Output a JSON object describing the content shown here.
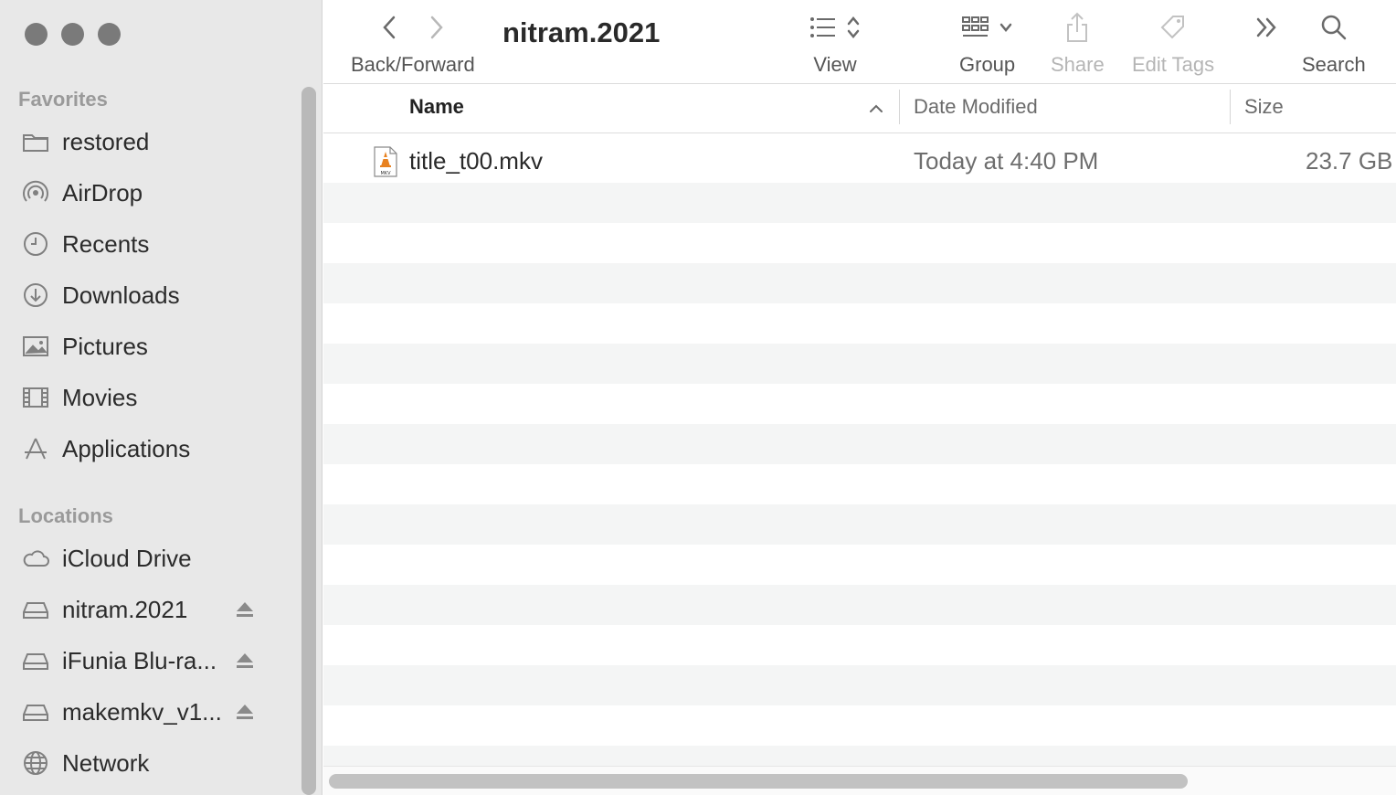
{
  "toolbar": {
    "title": "nitram.2021",
    "back_forward_label": "Back/Forward",
    "view_label": "View",
    "group_label": "Group",
    "share_label": "Share",
    "edit_tags_label": "Edit Tags",
    "search_label": "Search"
  },
  "sidebar": {
    "favorites_header": "Favorites",
    "locations_header": "Locations",
    "favorites": [
      {
        "label": "restored",
        "icon": "folder-icon"
      },
      {
        "label": "AirDrop",
        "icon": "airdrop-icon"
      },
      {
        "label": "Recents",
        "icon": "clock-icon"
      },
      {
        "label": "Downloads",
        "icon": "download-icon"
      },
      {
        "label": "Pictures",
        "icon": "photo-icon"
      },
      {
        "label": "Movies",
        "icon": "film-icon"
      },
      {
        "label": "Applications",
        "icon": "applications-icon"
      }
    ],
    "locations": [
      {
        "label": "iCloud Drive",
        "icon": "cloud-icon"
      },
      {
        "label": "nitram.2021",
        "icon": "drive-icon",
        "eject": true
      },
      {
        "label": "iFunia Blu-ra...",
        "icon": "drive-icon",
        "eject": true
      },
      {
        "label": "makemkv_v1...",
        "icon": "drive-icon",
        "eject": true
      },
      {
        "label": "Network",
        "icon": "globe-icon"
      }
    ]
  },
  "columns": {
    "name": "Name",
    "date_modified": "Date Modified",
    "size": "Size"
  },
  "files": [
    {
      "name": "title_t00.mkv",
      "date_modified": "Today at 4:40 PM",
      "size": "23.7 GB",
      "icon": "mkv-file-icon"
    }
  ]
}
